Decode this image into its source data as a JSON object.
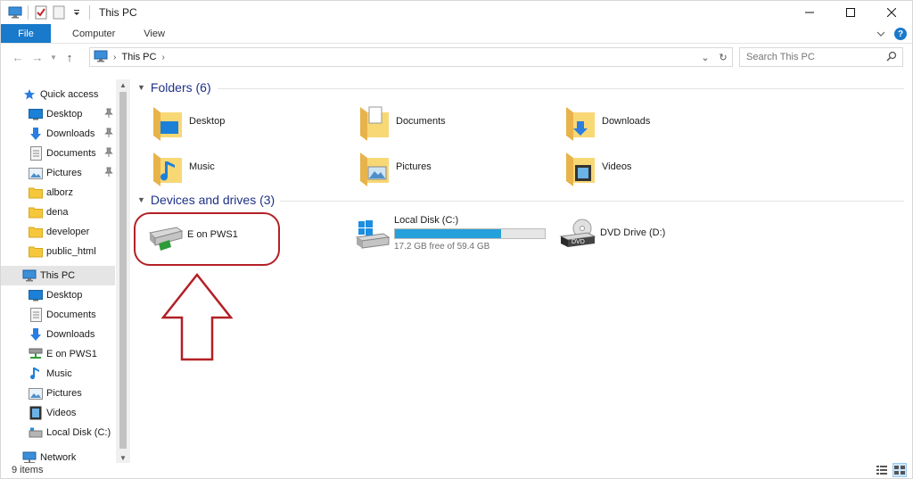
{
  "window": {
    "title": "This PC"
  },
  "ribbon": {
    "tabs": [
      {
        "label": "File"
      },
      {
        "label": "Computer"
      },
      {
        "label": "View"
      }
    ]
  },
  "address": {
    "path": [
      "This PC"
    ]
  },
  "search": {
    "placeholder": "Search This PC"
  },
  "sidebar": {
    "items": [
      {
        "label": "Quick access",
        "icon": "star-icon",
        "pinned": false
      },
      {
        "label": "Desktop",
        "icon": "desktop-icon",
        "pinned": true
      },
      {
        "label": "Downloads",
        "icon": "download-arrow-icon",
        "pinned": true
      },
      {
        "label": "Documents",
        "icon": "document-icon",
        "pinned": true
      },
      {
        "label": "Pictures",
        "icon": "pictures-icon",
        "pinned": true
      },
      {
        "label": "alborz",
        "icon": "folder-icon",
        "pinned": false
      },
      {
        "label": "dena",
        "icon": "folder-icon",
        "pinned": false
      },
      {
        "label": "developer",
        "icon": "folder-icon",
        "pinned": false
      },
      {
        "label": "public_html",
        "icon": "folder-icon",
        "pinned": false
      },
      {
        "label": "This PC",
        "icon": "computer-icon",
        "pinned": false,
        "selected": true
      },
      {
        "label": "Desktop",
        "icon": "desktop-icon",
        "pinned": false
      },
      {
        "label": "Documents",
        "icon": "document-icon",
        "pinned": false
      },
      {
        "label": "Downloads",
        "icon": "download-arrow-icon",
        "pinned": false
      },
      {
        "label": "E on PWS1",
        "icon": "network-drive-icon",
        "pinned": false
      },
      {
        "label": "Music",
        "icon": "music-note-icon",
        "pinned": false
      },
      {
        "label": "Pictures",
        "icon": "pictures-icon",
        "pinned": false
      },
      {
        "label": "Videos",
        "icon": "film-icon",
        "pinned": false
      },
      {
        "label": "Local Disk (C:)",
        "icon": "local-disk-icon",
        "pinned": false
      },
      {
        "label": "Network",
        "icon": "network-icon",
        "pinned": false
      }
    ]
  },
  "folders": {
    "header": "Folders (6)",
    "items": [
      {
        "label": "Desktop",
        "icon": "desktop-folder-icon"
      },
      {
        "label": "Documents",
        "icon": "documents-folder-icon"
      },
      {
        "label": "Downloads",
        "icon": "downloads-folder-icon"
      },
      {
        "label": "Music",
        "icon": "music-folder-icon"
      },
      {
        "label": "Pictures",
        "icon": "pictures-folder-icon"
      },
      {
        "label": "Videos",
        "icon": "videos-folder-icon"
      }
    ]
  },
  "drives": {
    "header": "Devices and drives (3)",
    "items": [
      {
        "label": "E on PWS1",
        "icon": "network-drive-icon"
      },
      {
        "label": "Local Disk (C:)",
        "icon": "windows-disk-icon",
        "free_text": "17.2 GB free of 59.4 GB",
        "used_fraction": 0.71
      },
      {
        "label": "DVD Drive (D:)",
        "icon": "dvd-drive-icon",
        "disc_label": "DVD"
      }
    ]
  },
  "status": {
    "items_count": "9 items"
  },
  "colors": {
    "accent": "#1979ca",
    "annotation": "#b32026",
    "group_header": "#1e3287",
    "capacity": "#26a0da"
  }
}
